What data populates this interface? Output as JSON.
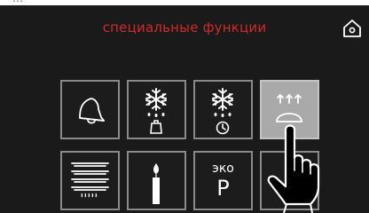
{
  "screen": {
    "title": "специальные функции",
    "colors": {
      "background": "#1a1a1a",
      "title": "#cf2b2b",
      "tile_border": "#8a8a8a",
      "tile_active": "#a9a9a9",
      "icon": "#ffffff"
    }
  },
  "home": {
    "icon": "home-icon"
  },
  "tiles": [
    {
      "name": "timer-bell",
      "icon": "bell-icon"
    },
    {
      "name": "defrost-by-weight",
      "icon": "snowflake-weight-icon"
    },
    {
      "name": "defrost-by-time",
      "icon": "snowflake-clock-icon"
    },
    {
      "name": "dough-proofing",
      "icon": "dough-rising-icon",
      "selected": true
    },
    {
      "name": "plate-warming",
      "icon": "plate-warming-icon"
    },
    {
      "name": "candle",
      "icon": "candle-icon"
    },
    {
      "name": "eco",
      "icon": "eco-p-icon",
      "label_top": "эко",
      "label_main": "P"
    },
    {
      "name": "more",
      "icon": "more-icon"
    }
  ],
  "pointer": {
    "icon": "hand-pointer-icon"
  }
}
